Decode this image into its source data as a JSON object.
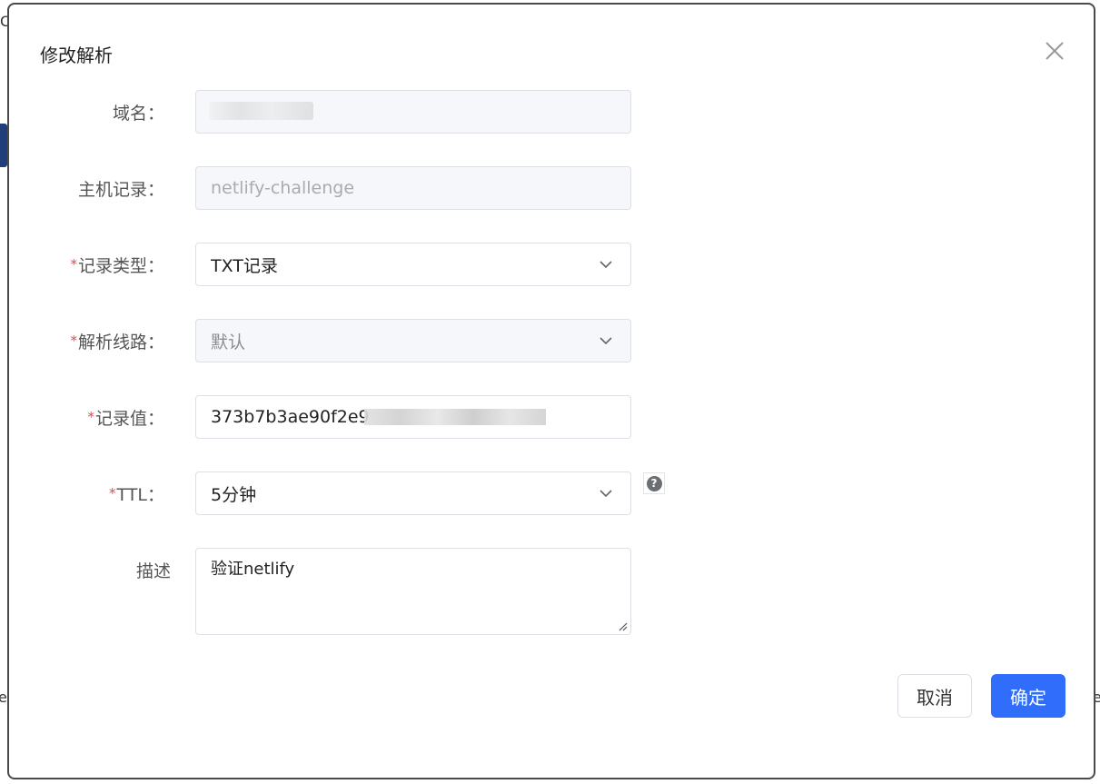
{
  "background": {
    "left_char": "e",
    "right_char": "e",
    "top_char": "C"
  },
  "dialog": {
    "title": "修改解析",
    "close_icon": "close-icon"
  },
  "form": {
    "domain": {
      "label": "域名",
      "value": ""
    },
    "host_record": {
      "label": "主机记录",
      "value": "netlify-challenge"
    },
    "record_type": {
      "label": "记录类型",
      "required": true,
      "value": "TXT记录"
    },
    "resolution_line": {
      "label": "解析线路",
      "required": true,
      "value": "默认"
    },
    "record_value": {
      "label": "记录值",
      "required": true,
      "value": "373b7b3ae90f2e9"
    },
    "ttl": {
      "label": "TTL",
      "required": true,
      "value": "5分钟",
      "help_icon": "question-icon"
    },
    "description": {
      "label": "描述",
      "value": "验证netlify"
    },
    "label_suffix": "："
  },
  "footer": {
    "cancel_label": "取消",
    "confirm_label": "确定"
  },
  "colors": {
    "primary": "#2f6dfa",
    "required": "#e5484d"
  }
}
